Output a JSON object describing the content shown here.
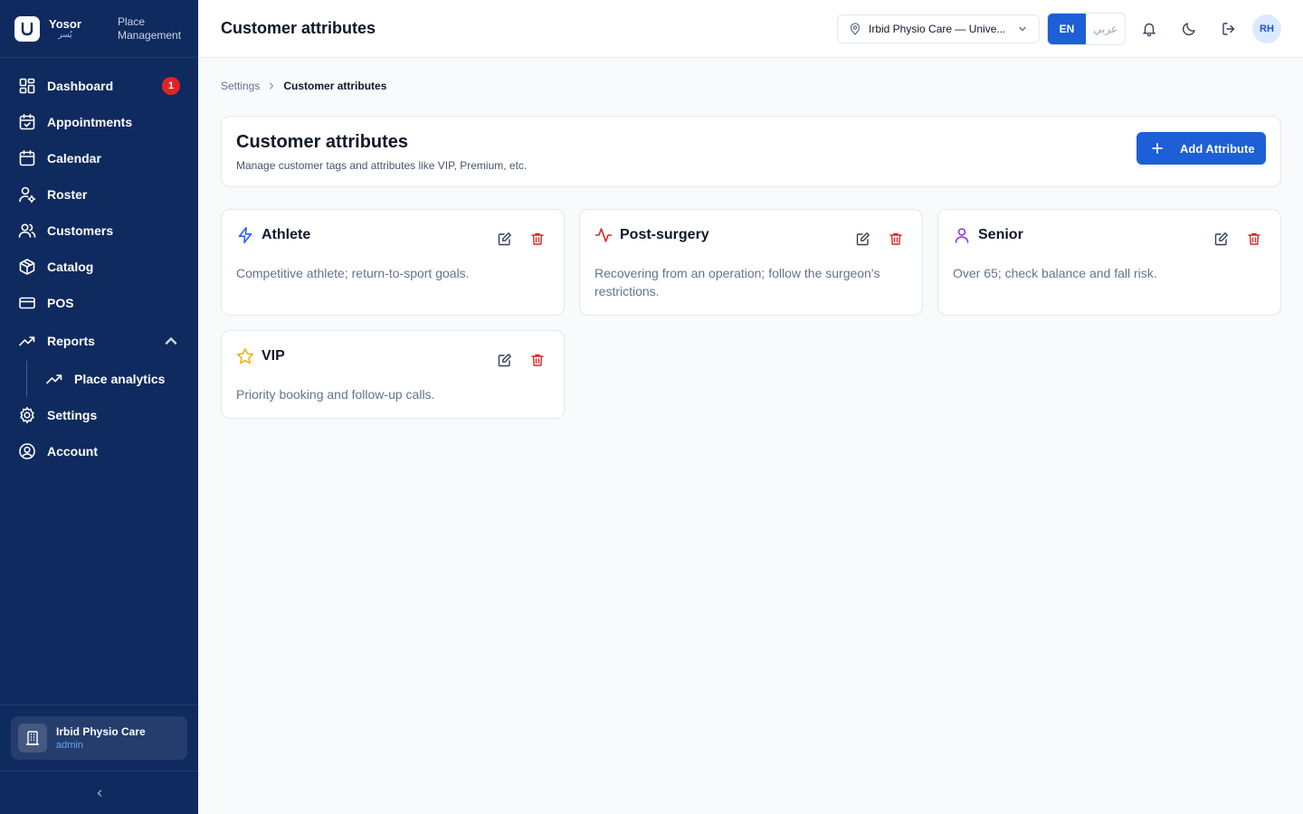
{
  "brand": {
    "name": "Yosor",
    "name_ar": "يُسر",
    "subtitle": "Place Management"
  },
  "sidebar": {
    "items": [
      {
        "label": "Dashboard",
        "icon": "dashboard-icon",
        "badge": "1"
      },
      {
        "label": "Appointments",
        "icon": "calendar-check-icon"
      },
      {
        "label": "Calendar",
        "icon": "calendar-icon"
      },
      {
        "label": "Roster",
        "icon": "user-cog-icon"
      },
      {
        "label": "Customers",
        "icon": "users-icon"
      },
      {
        "label": "Catalog",
        "icon": "package-icon"
      },
      {
        "label": "POS",
        "icon": "credit-card-icon"
      },
      {
        "label": "Reports",
        "icon": "trending-up-icon",
        "expanded": true
      },
      {
        "label": "Place analytics",
        "icon": "trending-up-icon"
      },
      {
        "label": "Settings",
        "icon": "gear-icon"
      },
      {
        "label": "Account",
        "icon": "user-circle-icon"
      }
    ],
    "place": {
      "name": "Irbid Physio Care",
      "role": "admin"
    }
  },
  "header": {
    "title": "Customer attributes",
    "place_select": "Irbid Physio Care — Unive...",
    "lang_en": "EN",
    "lang_ar": "عربي",
    "avatar": "RH"
  },
  "breadcrumb": {
    "parent": "Settings",
    "current": "Customer attributes"
  },
  "page": {
    "title": "Customer attributes",
    "subtitle": "Manage customer tags and attributes like VIP, Premium, etc.",
    "add_button": "Add Attribute"
  },
  "attributes": [
    {
      "name": "Athlete",
      "description": "Competitive athlete; return-to-sport goals.",
      "icon": "zap-icon",
      "color": "#2563eb"
    },
    {
      "name": "Post-surgery",
      "description": "Recovering from an operation; follow the surgeon's restrictions.",
      "icon": "activity-icon",
      "color": "#dc2626"
    },
    {
      "name": "Senior",
      "description": "Over 65; check balance and fall risk.",
      "icon": "user-icon",
      "color": "#9333ea"
    },
    {
      "name": "VIP",
      "description": "Priority booking and follow-up calls.",
      "icon": "star-icon",
      "color": "#eab308"
    }
  ],
  "colors": {
    "sidebar": "#0f2a5f",
    "primary": "#1d5fd6",
    "danger": "#dc2626"
  }
}
